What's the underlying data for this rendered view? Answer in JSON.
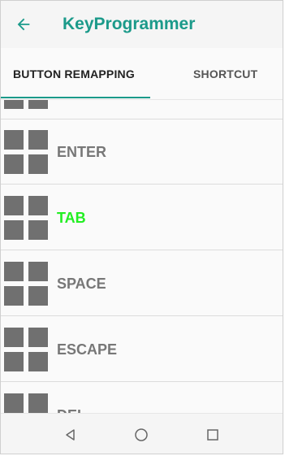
{
  "appbar": {
    "title": "KeyProgrammer",
    "back_icon": "arrow-left-icon"
  },
  "tabs": [
    {
      "label": "BUTTON REMAPPING",
      "selected": true
    },
    {
      "label": "SHORTCUT",
      "selected": false
    }
  ],
  "list": {
    "items": [
      {
        "label": "ENTER",
        "icon": "grid-icon",
        "active": false
      },
      {
        "label": "TAB",
        "icon": "grid-icon",
        "active": true
      },
      {
        "label": "SPACE",
        "icon": "grid-icon",
        "active": false
      },
      {
        "label": "ESCAPE",
        "icon": "grid-icon",
        "active": false
      },
      {
        "label": "DEL",
        "icon": "grid-icon",
        "active": false
      }
    ]
  },
  "navbar": {
    "back": "triangle-back-icon",
    "home": "circle-home-icon",
    "recents": "square-recents-icon"
  },
  "colors": {
    "accent": "#1b9a8a",
    "active_item": "#22ee22",
    "icon_gray": "#707070"
  }
}
